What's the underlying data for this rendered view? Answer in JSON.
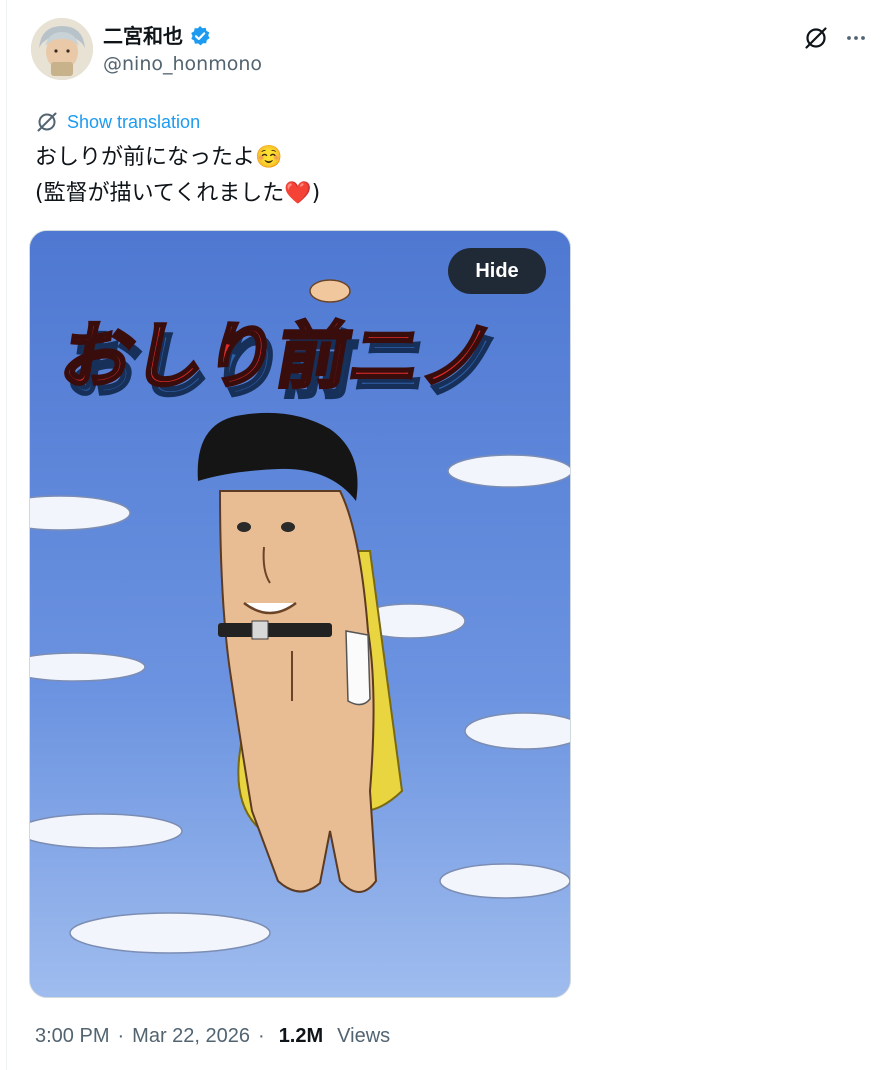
{
  "author": {
    "display_name": "二宮和也",
    "handle": "@nino_honmono",
    "verified": true,
    "avatar_icon": "avatar-photo"
  },
  "icons": {
    "verified": "verified-badge-icon",
    "grok": "slashed-circle-icon",
    "more": "more-horizontal-icon",
    "translate": "slashed-circle-icon"
  },
  "translation": {
    "label": "Show translation"
  },
  "tweet": {
    "text": "おしりが前になったよ☺️\n(監督が描いてくれました❤️)"
  },
  "media": {
    "hide_label": "Hide",
    "illustration_title": "おしり前ニノ"
  },
  "footer": {
    "time": "3:00 PM",
    "date": "Mar 22, 2026",
    "separator": "·",
    "views_count": "1.2M",
    "views_label": "Views"
  },
  "colors": {
    "link": "#1d9bf0",
    "muted": "#536471",
    "text": "#0f1419",
    "sky": "#5b82d8"
  }
}
